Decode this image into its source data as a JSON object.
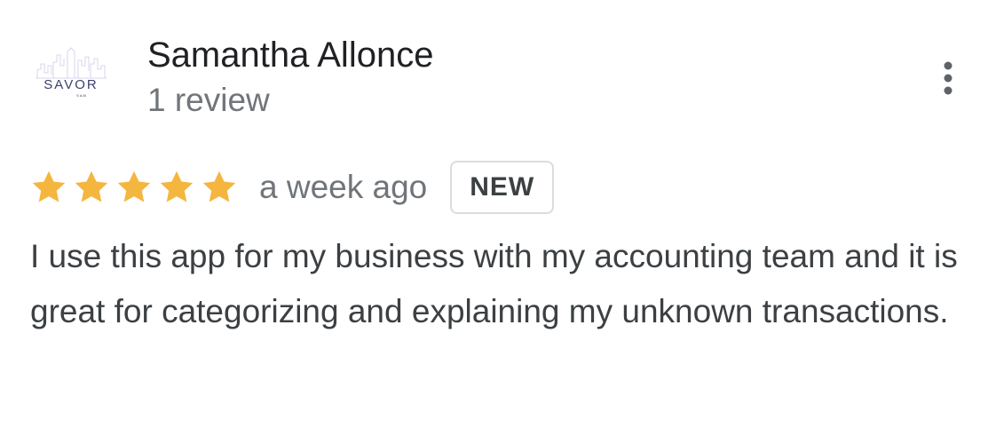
{
  "review": {
    "author": {
      "name": "Samantha Allonce",
      "review_count": "1 review",
      "avatar_logo": {
        "text": "SAVOR",
        "subtext": "SAM"
      }
    },
    "menu_icon": "more-vertical-icon",
    "rating": {
      "stars": 5,
      "max_stars": 5,
      "star_color": "#f4b63f",
      "icon": "star-icon"
    },
    "time": "a week ago",
    "badge": "NEW",
    "text": "I use this app for my business with my accounting team and it is great for categorizing and explaining my unknown transactions."
  },
  "colors": {
    "primary_text": "#202124",
    "secondary_text": "#70757a",
    "body_text": "#3c4043",
    "badge_border": "#dadce0",
    "star": "#f4b63f",
    "logo_primary": "#3b3f6b",
    "logo_skyline": "#c8c4e8"
  }
}
